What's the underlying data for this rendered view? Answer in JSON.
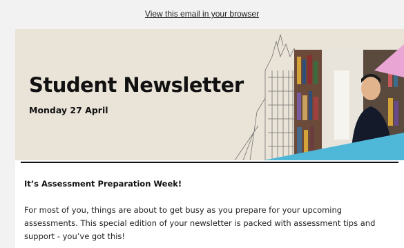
{
  "preheader": {
    "link_text": "View this email in your browser"
  },
  "banner": {
    "title": "Student Newsletter",
    "date": "Monday 27 April",
    "colors": {
      "background": "#e9e3d8",
      "accent_pink": "#e9a6d4",
      "accent_blue": "#4fb8d8"
    }
  },
  "content": {
    "heading": "It’s Assessment Preparation Week!",
    "paragraph": "For most of you, things are about to get busy as you prepare for your upcoming assessments. This special edition of your newsletter is packed with assessment tips and support - you’ve got this!"
  }
}
